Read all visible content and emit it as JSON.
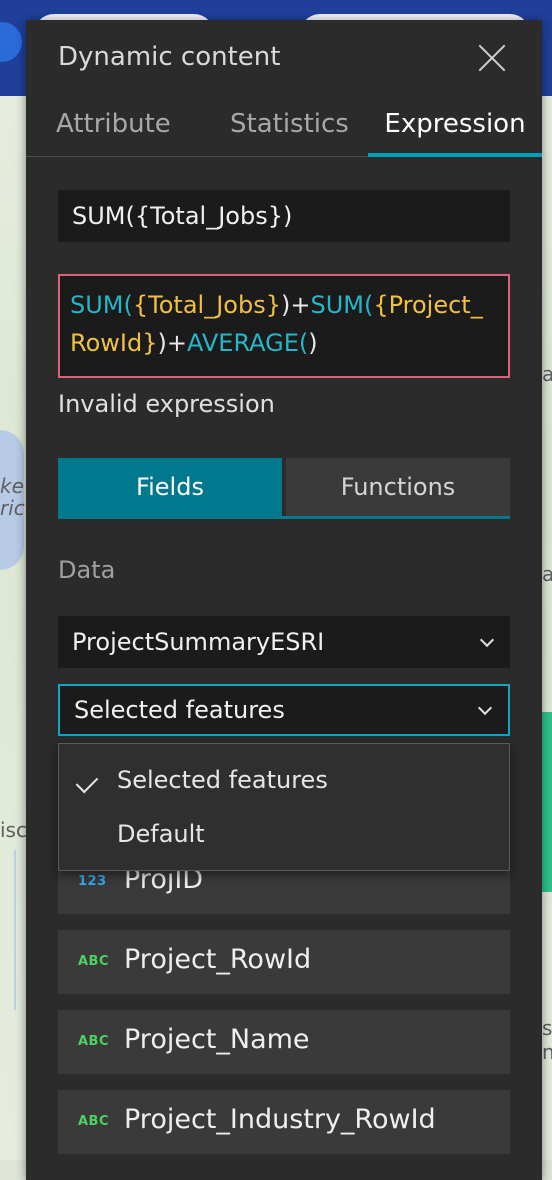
{
  "panel": {
    "title": "Dynamic content"
  },
  "tabs": [
    {
      "label": "Attribute"
    },
    {
      "label": "Statistics"
    },
    {
      "label": "Expression",
      "active": true
    }
  ],
  "expression": {
    "name_value": "SUM({Total_Jobs})",
    "tokens": [
      {
        "text": "SUM(",
        "kind": "function"
      },
      {
        "text": "{Total_Jobs}",
        "kind": "field"
      },
      {
        "text": ")+",
        "kind": "operator"
      },
      {
        "text": "SUM(",
        "kind": "function"
      },
      {
        "text": "{Project_RowId}",
        "kind": "field"
      },
      {
        "text": ")+",
        "kind": "operator"
      },
      {
        "text": "AVERAGE(",
        "kind": "function"
      },
      {
        "text": ")",
        "kind": "operator"
      }
    ],
    "status": "Invalid expression"
  },
  "segment": {
    "fields_label": "Fields",
    "functions_label": "Functions",
    "selected": "Fields"
  },
  "data_section": {
    "label": "Data",
    "source_select": "ProjectSummaryESRI",
    "scope_select": "Selected features",
    "scope_options": [
      {
        "label": "Selected features",
        "checked": true
      },
      {
        "label": "Default",
        "checked": false
      }
    ]
  },
  "fields": [
    {
      "type": "123",
      "name": "ProjID"
    },
    {
      "type": "ABC",
      "name": "Project_RowId"
    },
    {
      "type": "ABC",
      "name": "Project_Name"
    },
    {
      "type": "ABC",
      "name": "Project_Industry_RowId"
    }
  ],
  "map_labels": {
    "left_a": "ke",
    "left_b": "ric",
    "left_c": "isc",
    "right_a": "a",
    "right_b": "a",
    "right_c": "s",
    "right_d": "n"
  },
  "colors": {
    "accent": "#00798f",
    "function_token": "#25b6c8",
    "field_token": "#f0c040",
    "error_border": "#e0607a"
  }
}
